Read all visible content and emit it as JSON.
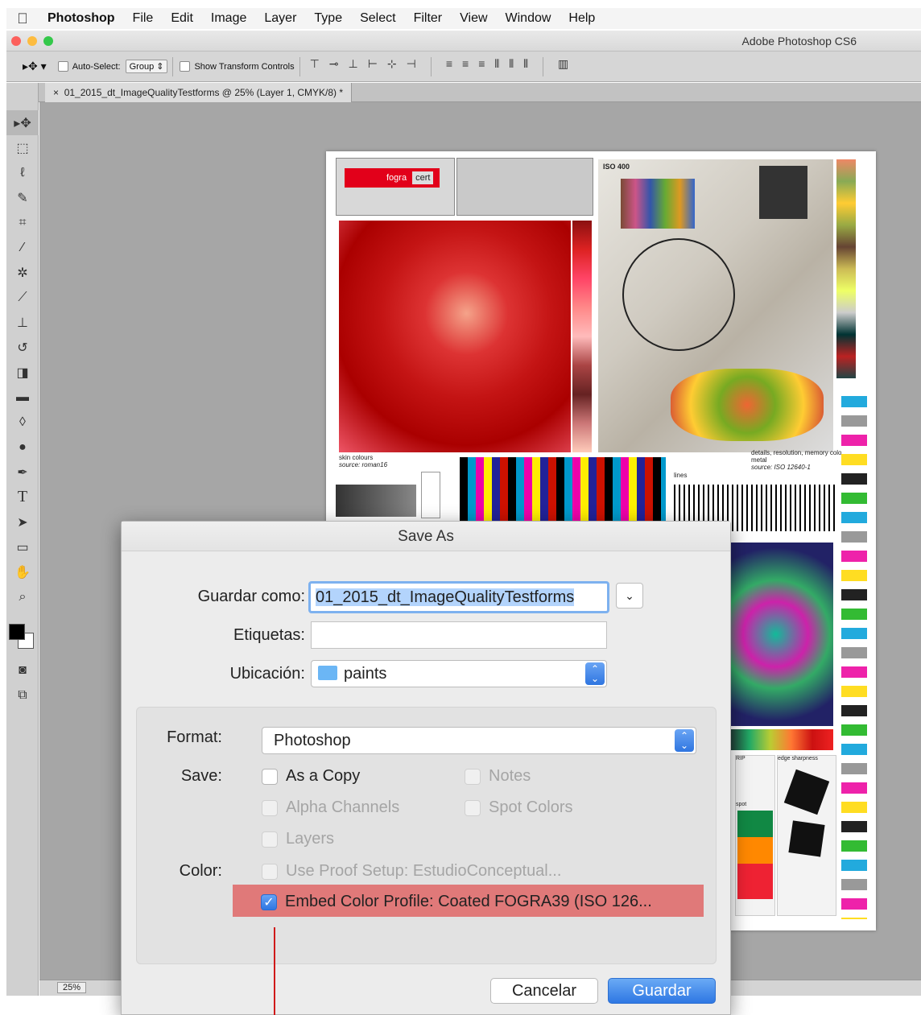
{
  "menubar": {
    "items": [
      "Photoshop",
      "File",
      "Edit",
      "Image",
      "Layer",
      "Type",
      "Select",
      "Filter",
      "View",
      "Window",
      "Help"
    ]
  },
  "window": {
    "title": "Adobe Photoshop CS6"
  },
  "options": {
    "auto_select_label": "Auto-Select:",
    "auto_select_value": "Group",
    "show_transform_label": "Show Transform Controls"
  },
  "document": {
    "tab_title": "01_2015_dt_ImageQualityTestforms @ 25% (Layer 1, CMYK/8) *",
    "zoom": "25%",
    "labels": {
      "iso": "ISO 400",
      "fogra": "fogra",
      "cert": "cert",
      "skin": "skin colours",
      "skin_source": "source: roman16",
      "details": "details, resolution, memory colours, metal",
      "details_source": "source: ISO 12640-1",
      "lines": "lines",
      "rip": "RIP",
      "edge": "edge sharpness",
      "spot": "spot"
    }
  },
  "dialog": {
    "title": "Save As",
    "save_as_label": "Guardar como:",
    "save_as_value": "01_2015_dt_ImageQualityTestforms",
    "tags_label": "Etiquetas:",
    "location_label": "Ubicación:",
    "location_value": "paints",
    "format_label": "Format:",
    "format_value": "Photoshop",
    "save_label": "Save:",
    "color_label": "Color:",
    "options": {
      "as_copy": "As a Copy",
      "notes": "Notes",
      "alpha": "Alpha Channels",
      "spot": "Spot Colors",
      "layers": "Layers",
      "proof": "Use Proof Setup:  EstudioConceptual...",
      "embed": "Embed Color Profile:  Coated FOGRA39 (ISO 126..."
    },
    "cancel_label": "Cancelar",
    "save_button_label": "Guardar"
  },
  "colors": {
    "highlight": "#e07979",
    "accent": "#2f76e2",
    "pointer": "#d01a1a"
  }
}
